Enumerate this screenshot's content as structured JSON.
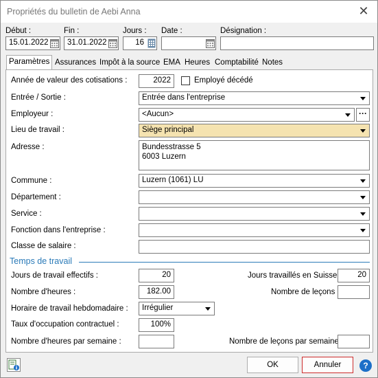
{
  "window": {
    "title": "Propriétés du bulletin de Aebi Anna",
    "close_icon": "close-icon"
  },
  "top": {
    "debut_label": "Début :",
    "debut_value": "15.01.2022",
    "fin_label": "Fin :",
    "fin_value": "31.01.2022",
    "jours_label": "Jours :",
    "jours_value": "16",
    "date_label": "Date :",
    "date_value": "",
    "designation_label": "Désignation :",
    "designation_value": ""
  },
  "tabs": [
    "Paramètres",
    "Assurances",
    "Impôt à la source",
    "EMA",
    "Heures",
    "Comptabilité",
    "Notes"
  ],
  "form": {
    "annee_label": "Année de valeur des cotisations :",
    "annee_value": "2022",
    "employe_decede_label": "Employé décédé",
    "entree_label": "Entrée / Sortie :",
    "entree_value": "Entrée dans l'entreprise",
    "employeur_label": "Employeur :",
    "employeur_value": "<Aucun>",
    "lieu_label": "Lieu de travail :",
    "lieu_value": "Siège principal",
    "adresse_label": "Adresse :",
    "adresse_line1": "Bundesstrasse 5",
    "adresse_line2": "6003 Luzern",
    "commune_label": "Commune :",
    "commune_value": "Luzern (1061) LU",
    "departement_label": "Département :",
    "departement_value": "",
    "service_label": "Service :",
    "service_value": "",
    "fonction_label": "Fonction dans l'entreprise :",
    "fonction_value": "",
    "classe_label": "Classe de salaire :",
    "classe_value": ""
  },
  "temps": {
    "section_title": "Temps de travail",
    "jours_effectifs_label": "Jours de travail effectifs :",
    "jours_effectifs_value": "20",
    "jours_suisse_label": "Jours travaillés en Suisse :",
    "jours_suisse_value": "20",
    "nb_heures_label": "Nombre d'heures :",
    "nb_heures_value": "182.00",
    "nb_lecons_label": "Nombre de leçons :",
    "nb_lecons_value": "",
    "horaire_label": "Horaire de travail hebdomadaire :",
    "horaire_value": "Irrégulier",
    "taux_label": "Taux d'occupation contractuel :",
    "taux_value": "100%",
    "heures_semaine_label": "Nombre d'heures par semaine :",
    "heures_semaine_value": "",
    "lecons_semaine_label": "Nombre de leçons par semaine :",
    "lecons_semaine_value": ""
  },
  "footer": {
    "ok_label": "OK",
    "cancel_label": "Annuler",
    "help_label": "?"
  },
  "colors": {
    "accent": "#2a7ab8",
    "highlight": "#f5e3b0",
    "cancel_border": "#cc2a2a",
    "help": "#1c6fc8"
  }
}
